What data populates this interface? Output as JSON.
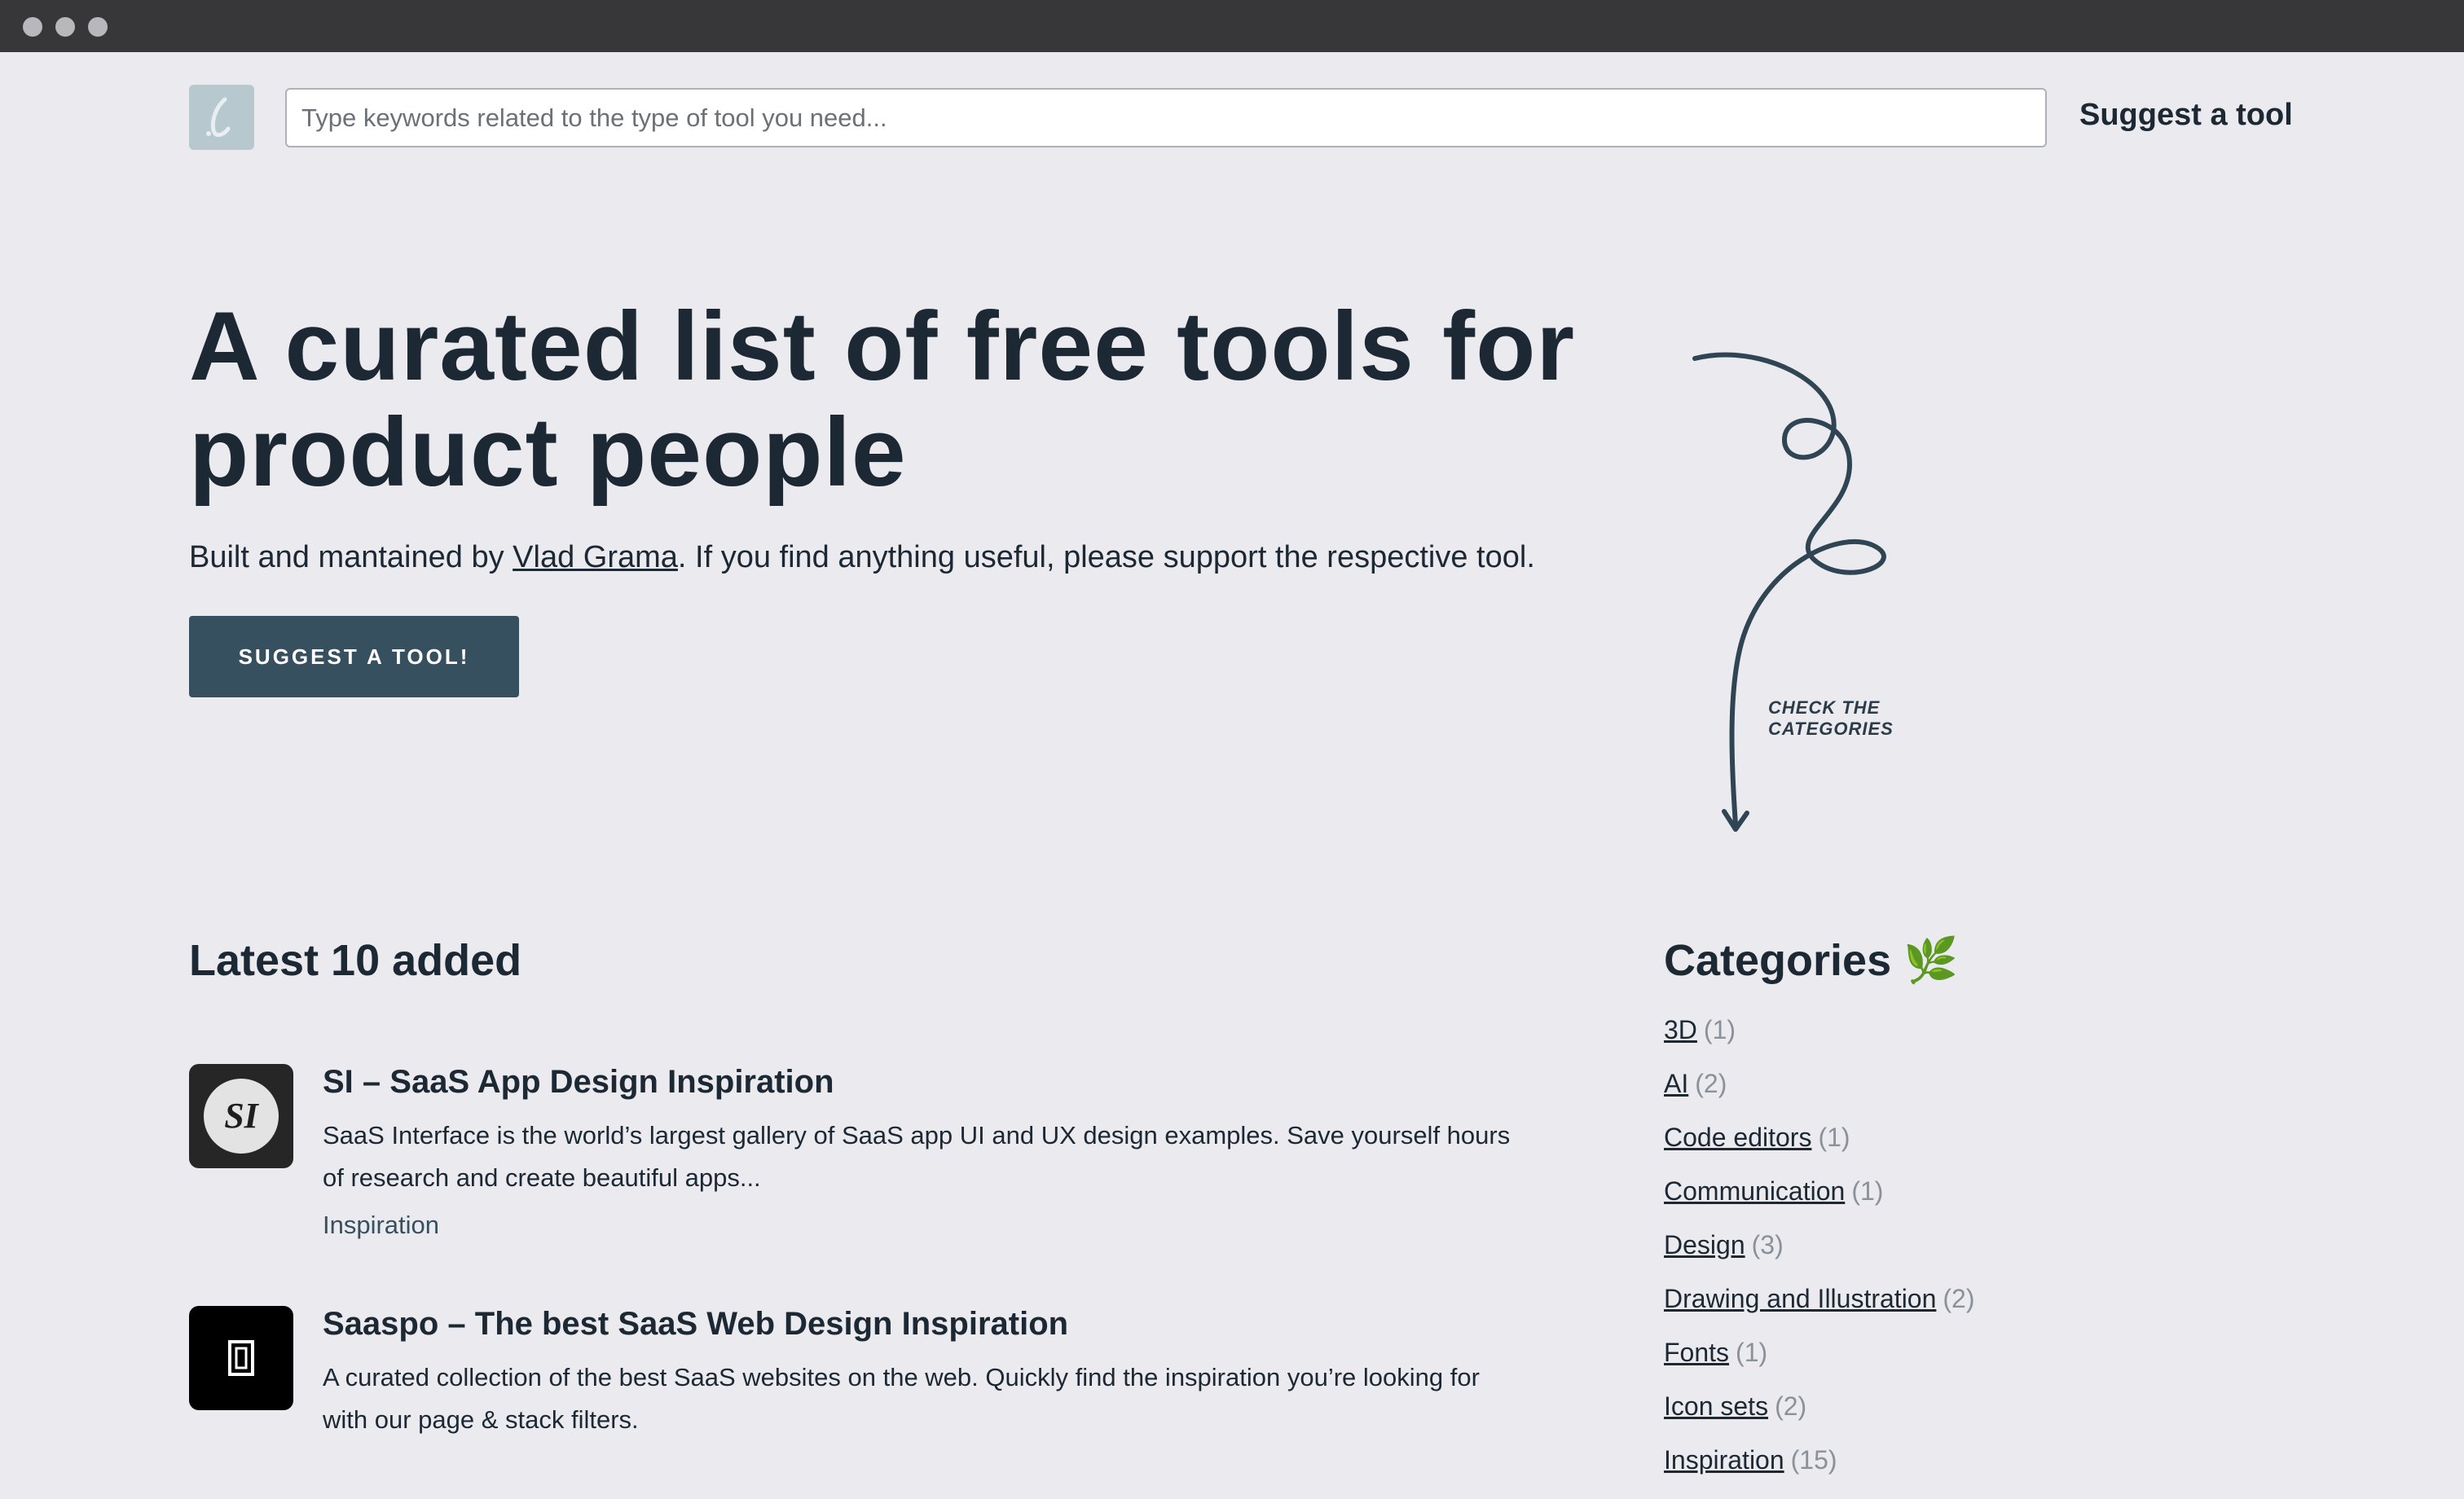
{
  "header": {
    "search_placeholder": "Type keywords related to the type of tool you need...",
    "suggest_link": "Suggest a tool"
  },
  "hero": {
    "title_part1": "A curated list of ",
    "title_bold1": "free tools",
    "title_part2": " for",
    "title_bold2": "product people",
    "sub_prefix": "Built and mantained by ",
    "sub_link": "Vlad Grama",
    "sub_suffix": ". If you find anything useful, please support the respective tool.",
    "cta_label": "SUGGEST A TOOL!",
    "arrow_note_line1": "CHECK THE",
    "arrow_note_line2": "CATEGORIES"
  },
  "latest": {
    "heading": "Latest 10 added",
    "tools": [
      {
        "icon": "si-logo-icon",
        "icon_text": "SI",
        "title": "SI – SaaS App Design Inspiration",
        "description": "SaaS Interface is the world’s largest gallery of SaaS app UI and UX design examples. Save yourself hours of research and create beautiful apps...",
        "tag": "Inspiration"
      },
      {
        "icon": "saaspo-logo-icon",
        "icon_text": "",
        "title": "Saaspo – The best SaaS Web Design Inspiration",
        "description": "A curated collection of the best SaaS websites on the web. Quickly find the inspiration you’re looking for with our page & stack filters.",
        "tag": ""
      }
    ]
  },
  "categories": {
    "heading": "Categories",
    "heading_emoji": "🌿",
    "items": [
      {
        "label": "3D",
        "count": "(1)"
      },
      {
        "label": "AI",
        "count": "(2)"
      },
      {
        "label": "Code editors",
        "count": "(1)"
      },
      {
        "label": "Communication",
        "count": "(1)"
      },
      {
        "label": "Design",
        "count": "(3)"
      },
      {
        "label": "Drawing and Illustration",
        "count": "(2)"
      },
      {
        "label": "Fonts",
        "count": "(1)"
      },
      {
        "label": "Icon sets",
        "count": "(2)"
      },
      {
        "label": "Inspiration",
        "count": "(15)"
      }
    ]
  },
  "colors": {
    "background": "#ebeaef",
    "accent": "#36505f",
    "text": "#1c2833"
  }
}
